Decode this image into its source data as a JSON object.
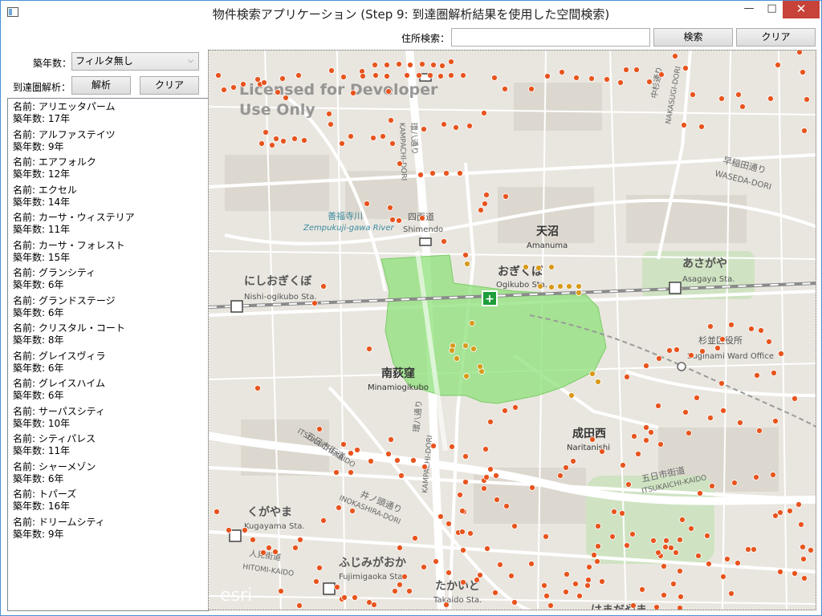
{
  "window": {
    "title": "物件検索アプリケーション (Step 9: 到達圏解析結果を使用した空間検索)",
    "controls": {
      "minimize": "—",
      "maximize": "□",
      "close": "✕"
    }
  },
  "search": {
    "label": "住所検索：",
    "value": "",
    "search_button": "検索",
    "clear_button": "クリア"
  },
  "filter": {
    "label": "築年数：",
    "selected": "フィルタ無し"
  },
  "analysis": {
    "label": "到達圏解析：",
    "analyze_button": "解析",
    "clear_button": "クリア"
  },
  "properties": [
    {
      "name": "名前: アリエッタパーム",
      "age": "築年数: 17年"
    },
    {
      "name": "名前: アルファステイツ",
      "age": "築年数: 9年"
    },
    {
      "name": "名前: エアフォルク",
      "age": "築年数: 12年"
    },
    {
      "name": "名前: エクセル",
      "age": "築年数: 14年"
    },
    {
      "name": "名前: カーサ・ウィステリア",
      "age": "築年数: 11年"
    },
    {
      "name": "名前: カーサ・フォレスト",
      "age": "築年数: 15年"
    },
    {
      "name": "名前: グランシティ",
      "age": "築年数: 6年"
    },
    {
      "name": "名前: グランドステージ",
      "age": "築年数: 6年"
    },
    {
      "name": "名前: クリスタル・コート",
      "age": "築年数: 8年"
    },
    {
      "name": "名前: グレイスヴィラ",
      "age": "築年数: 6年"
    },
    {
      "name": "名前: グレイスハイム",
      "age": "築年数: 6年"
    },
    {
      "name": "名前: サーパスシティ",
      "age": "築年数: 10年"
    },
    {
      "name": "名前: シティパレス",
      "age": "築年数: 11年"
    },
    {
      "name": "名前: シャーメゾン",
      "age": "築年数: 6年"
    },
    {
      "name": "名前: トパーズ",
      "age": "築年数: 16年"
    },
    {
      "name": "名前: ドリームシティ",
      "age": "築年数: 9年"
    }
  ],
  "map": {
    "watermark": "Licensed for Developer\nUse Only",
    "attribution": "esri",
    "labels": {
      "amanuma_jp": "天沼",
      "amanuma_en": "Amanuma",
      "ogikubo_jp": "おぎくぼ",
      "ogikubo_en": "Ogikubo Sta.",
      "asagaya_jp": "あさがや",
      "asagaya_en": "Asagaya Sta.",
      "nishiogikubo_jp": "にしおぎくぼ",
      "nishiogikubo_en": "Nishi-ogikubo Sta.",
      "minamiogikubo_jp": "南荻窪",
      "minamiogikubo_en": "Minamiogikubo",
      "naritanishi_jp": "成田西",
      "naritanishi_en": "Naritanishi",
      "kugayama_jp": "くがやま",
      "kugayama_en": "Kugayama Sta.",
      "fujimigaoka_jp": "ふじみがおか",
      "fujimigaoka_en": "Fujimigaoka Sta.",
      "takaido_jp": "たかいど",
      "takaido_en": "Takaido Sta.",
      "ward_office_jp": "杉並区役所",
      "ward_office_en": "Suginami Ward Office",
      "river_jp": "善福寺川",
      "river_en": "Zempukuji-gawa River",
      "shimendo": "四面道",
      "shimendo_en": "Shimendo",
      "waseda_jp": "早稲田通り",
      "waseda_en": "WASEDA-DORI",
      "itsukaichi_jp": "五日市街道",
      "itsukaichi_en": "ITSUKAICHI-KAIDO",
      "itsukaichi2_jp": "五日市街道",
      "itsukaichi2_en": "ITSUKAICHI-KAIDO",
      "inokashira_jp": "井ノ頭通り",
      "inokashira_en": "INOKASHIRA-DORI",
      "kampachi_jp": "環八通り",
      "kampachi_en": "KAMPACHI-DORI",
      "kampachi2_jp": "環八通り",
      "kampachi2_en": "KAMPACHI-DORI",
      "nakasugi_jp": "中杉通り",
      "nakasugi_en": "NAKASUGI-DORI",
      "hitomi_jp": "人見街道",
      "hitomi_en": "HITOMI-KAIDO",
      "hamadayama_jp": "はまだやま"
    },
    "colors": {
      "background": "#e9e6df",
      "road": "#ffffff",
      "rail": "#8a8a8a",
      "area": "#8ee07a",
      "marker": "#e8541e",
      "marker_in_area": "#d89a1a"
    }
  }
}
